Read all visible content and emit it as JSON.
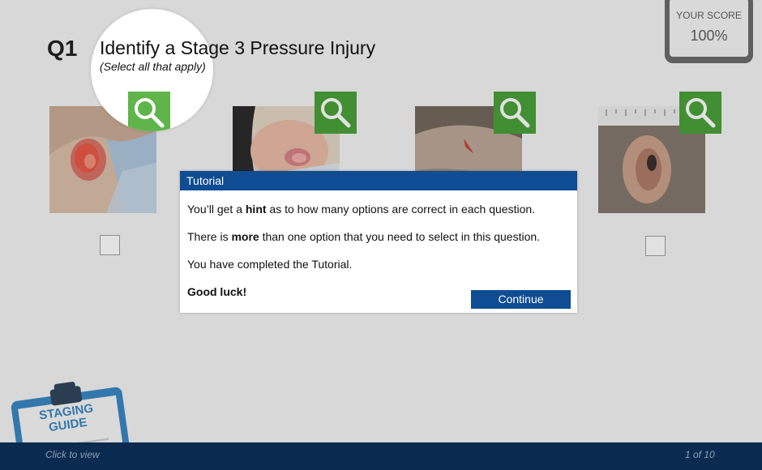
{
  "score": {
    "label": "YOUR SCORE",
    "value": "100%"
  },
  "question": {
    "number": "Q1",
    "title": "Identify a Stage 3 Pressure Injury",
    "subtitle": "(Select all that apply)"
  },
  "tutorial": {
    "header": "Tutorial",
    "line1_pre": "You’ll get a ",
    "line1_bold": "hint",
    "line1_post": " as to how many options are correct in each question.",
    "line2_pre": "There is ",
    "line2_bold": "more",
    "line2_post": " than one option that you need to select in this question.",
    "line3": "You have completed the Tutorial.",
    "line4": "Good luck!",
    "continue_label": "Continue"
  },
  "guide": {
    "line1": "STAGING",
    "line2": "GUIDE"
  },
  "footer": {
    "left": "Click to view",
    "right": "1 of 10"
  },
  "colors": {
    "brand_blue": "#0e4c93",
    "footer_navy": "#0b2a4f",
    "zoom_green": "#3e9a2b"
  },
  "icons": {
    "zoom": "magnifier-icon",
    "clipboard": "clipboard-icon"
  }
}
